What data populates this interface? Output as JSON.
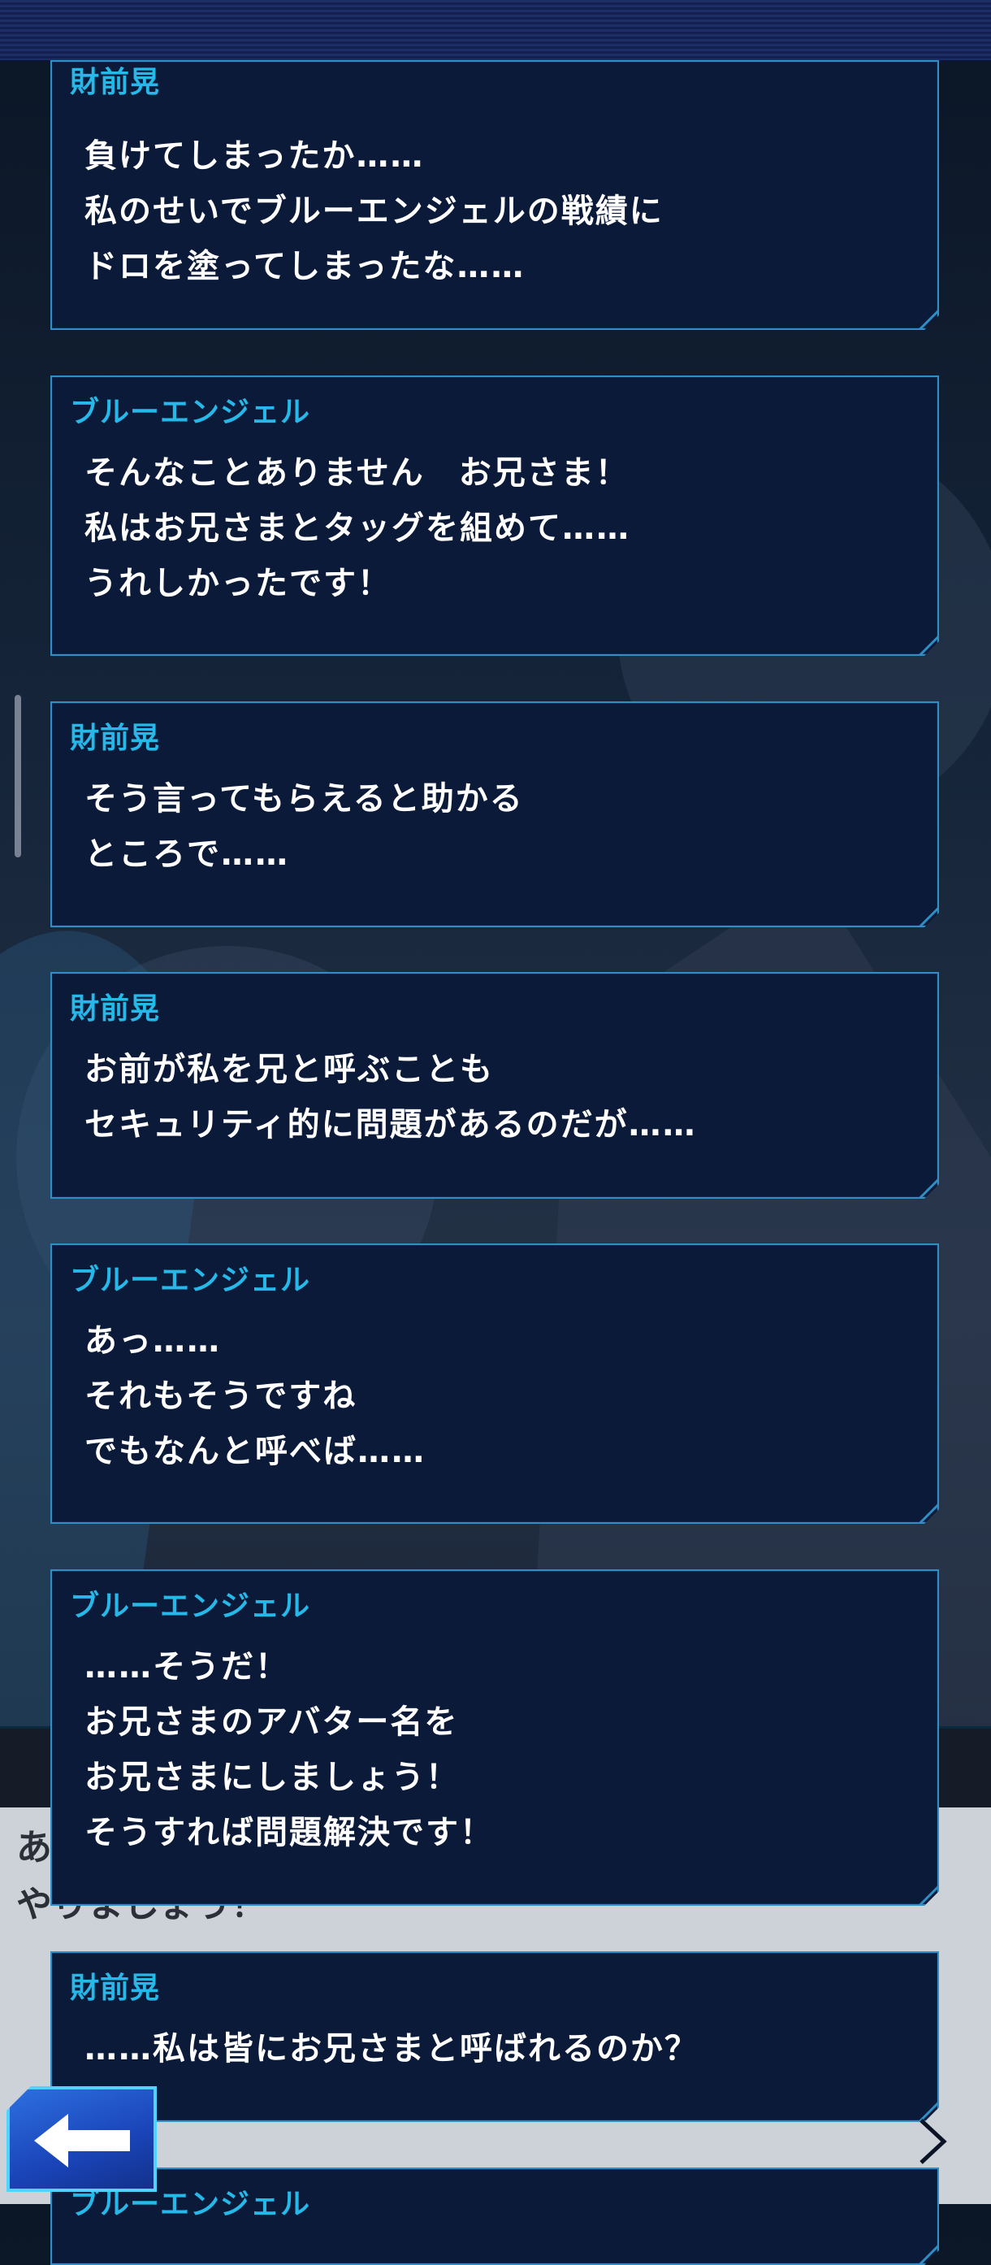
{
  "messages": [
    {
      "speaker": "財前晃",
      "lines": [
        "負けてしまったか……",
        "私のせいでブルーエンジェルの戦績に",
        "ドロを塗ってしまったな……"
      ]
    },
    {
      "speaker": "ブルーエンジェル",
      "lines": [
        "そんなことありません　お兄さま！",
        "私はお兄さまとタッグを組めて……",
        "うれしかったです！"
      ]
    },
    {
      "speaker": "財前晃",
      "lines": [
        "そう言ってもらえると助かる",
        "ところで……"
      ]
    },
    {
      "speaker": "財前晃",
      "lines": [
        "お前が私を兄と呼ぶことも",
        "セキュリティ的に問題があるのだが……"
      ]
    },
    {
      "speaker": "ブルーエンジェル",
      "lines": [
        "あっ……",
        "それもそうですね",
        "でもなんと呼べば……"
      ]
    },
    {
      "speaker": "ブルーエンジェル",
      "lines": [
        "……そうだ！",
        "お兄さまのアバター名を",
        "お兄さまにしましょう！",
        "そうすれば問題解決です！"
      ]
    },
    {
      "speaker": "財前晃",
      "lines": [
        "……私は皆にお兄さまと呼ばれるのか？"
      ]
    },
    {
      "speaker": "ブルーエンジェル",
      "lines": []
    }
  ],
  "background": {
    "lower_text_lines": [
      "あ",
      "やりましょう！"
    ]
  },
  "icons": {
    "back": "back-arrow-icon",
    "next": "chevron-right-icon"
  },
  "colors": {
    "speaker": "#25b8e8",
    "panel_bg": "#0b1a38",
    "panel_border": "#2f8fc4",
    "back_button": "#1a44b8"
  }
}
